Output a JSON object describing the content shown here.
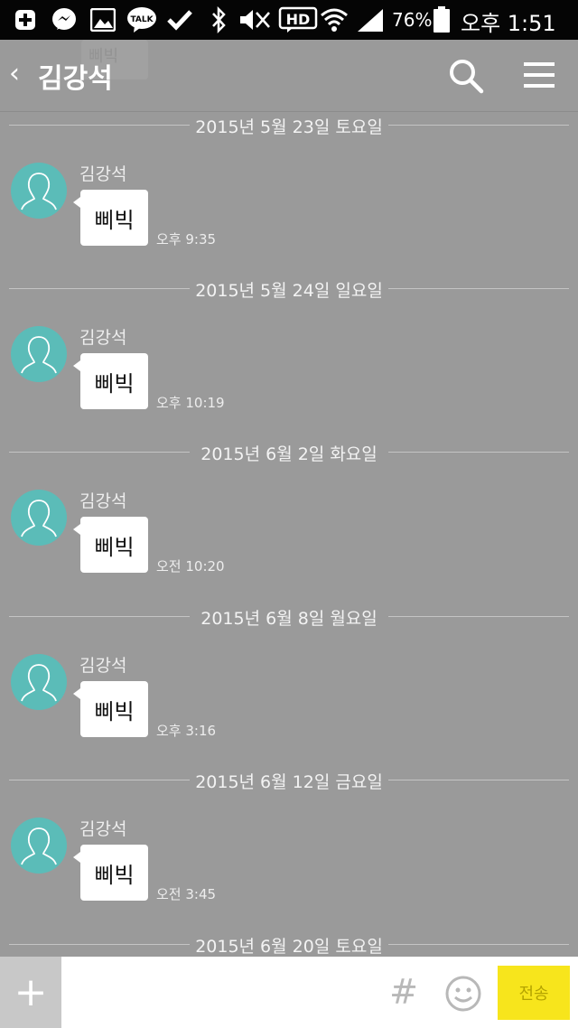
{
  "status_bar": {
    "battery_percent": "76%",
    "time": "오후 1:51",
    "icons": [
      "add-icon",
      "messenger-icon",
      "gallery-icon",
      "kakaotalk-icon",
      "check-icon",
      "bluetooth-icon",
      "mute-icon",
      "hd-icon",
      "wifi-icon",
      "signal-icon",
      "battery-icon"
    ],
    "talk_label": "TALK",
    "hd_label": "HD"
  },
  "header": {
    "back_glyph": "‹",
    "title": "김강석",
    "ghost_text": "삐빅"
  },
  "messages": [
    {
      "date": "2015년 5월 23일 토요일",
      "sender": "김강석",
      "text": "삐빅",
      "time": "오후 9:35"
    },
    {
      "date": "2015년 5월 24일 일요일",
      "sender": "김강석",
      "text": "삐빅",
      "time": "오후 10:19"
    },
    {
      "date": "2015년 6월 2일 화요일",
      "sender": "김강석",
      "text": "삐빅",
      "time": "오전 10:20"
    },
    {
      "date": "2015년 6월 8일 월요일",
      "sender": "김강석",
      "text": "삐빅",
      "time": "오후 3:16"
    },
    {
      "date": "2015년 6월 12일 금요일",
      "sender": "김강석",
      "text": "삐빅",
      "time": "오전 3:45"
    }
  ],
  "last_date": "2015년 6월 20일 토요일",
  "input_bar": {
    "plus": "+",
    "input_value": "",
    "hash": "#",
    "send_label": "전송"
  },
  "colors": {
    "background": "#9a9a9a",
    "avatar": "#5bbcb8",
    "send_button": "#f7e51c"
  }
}
